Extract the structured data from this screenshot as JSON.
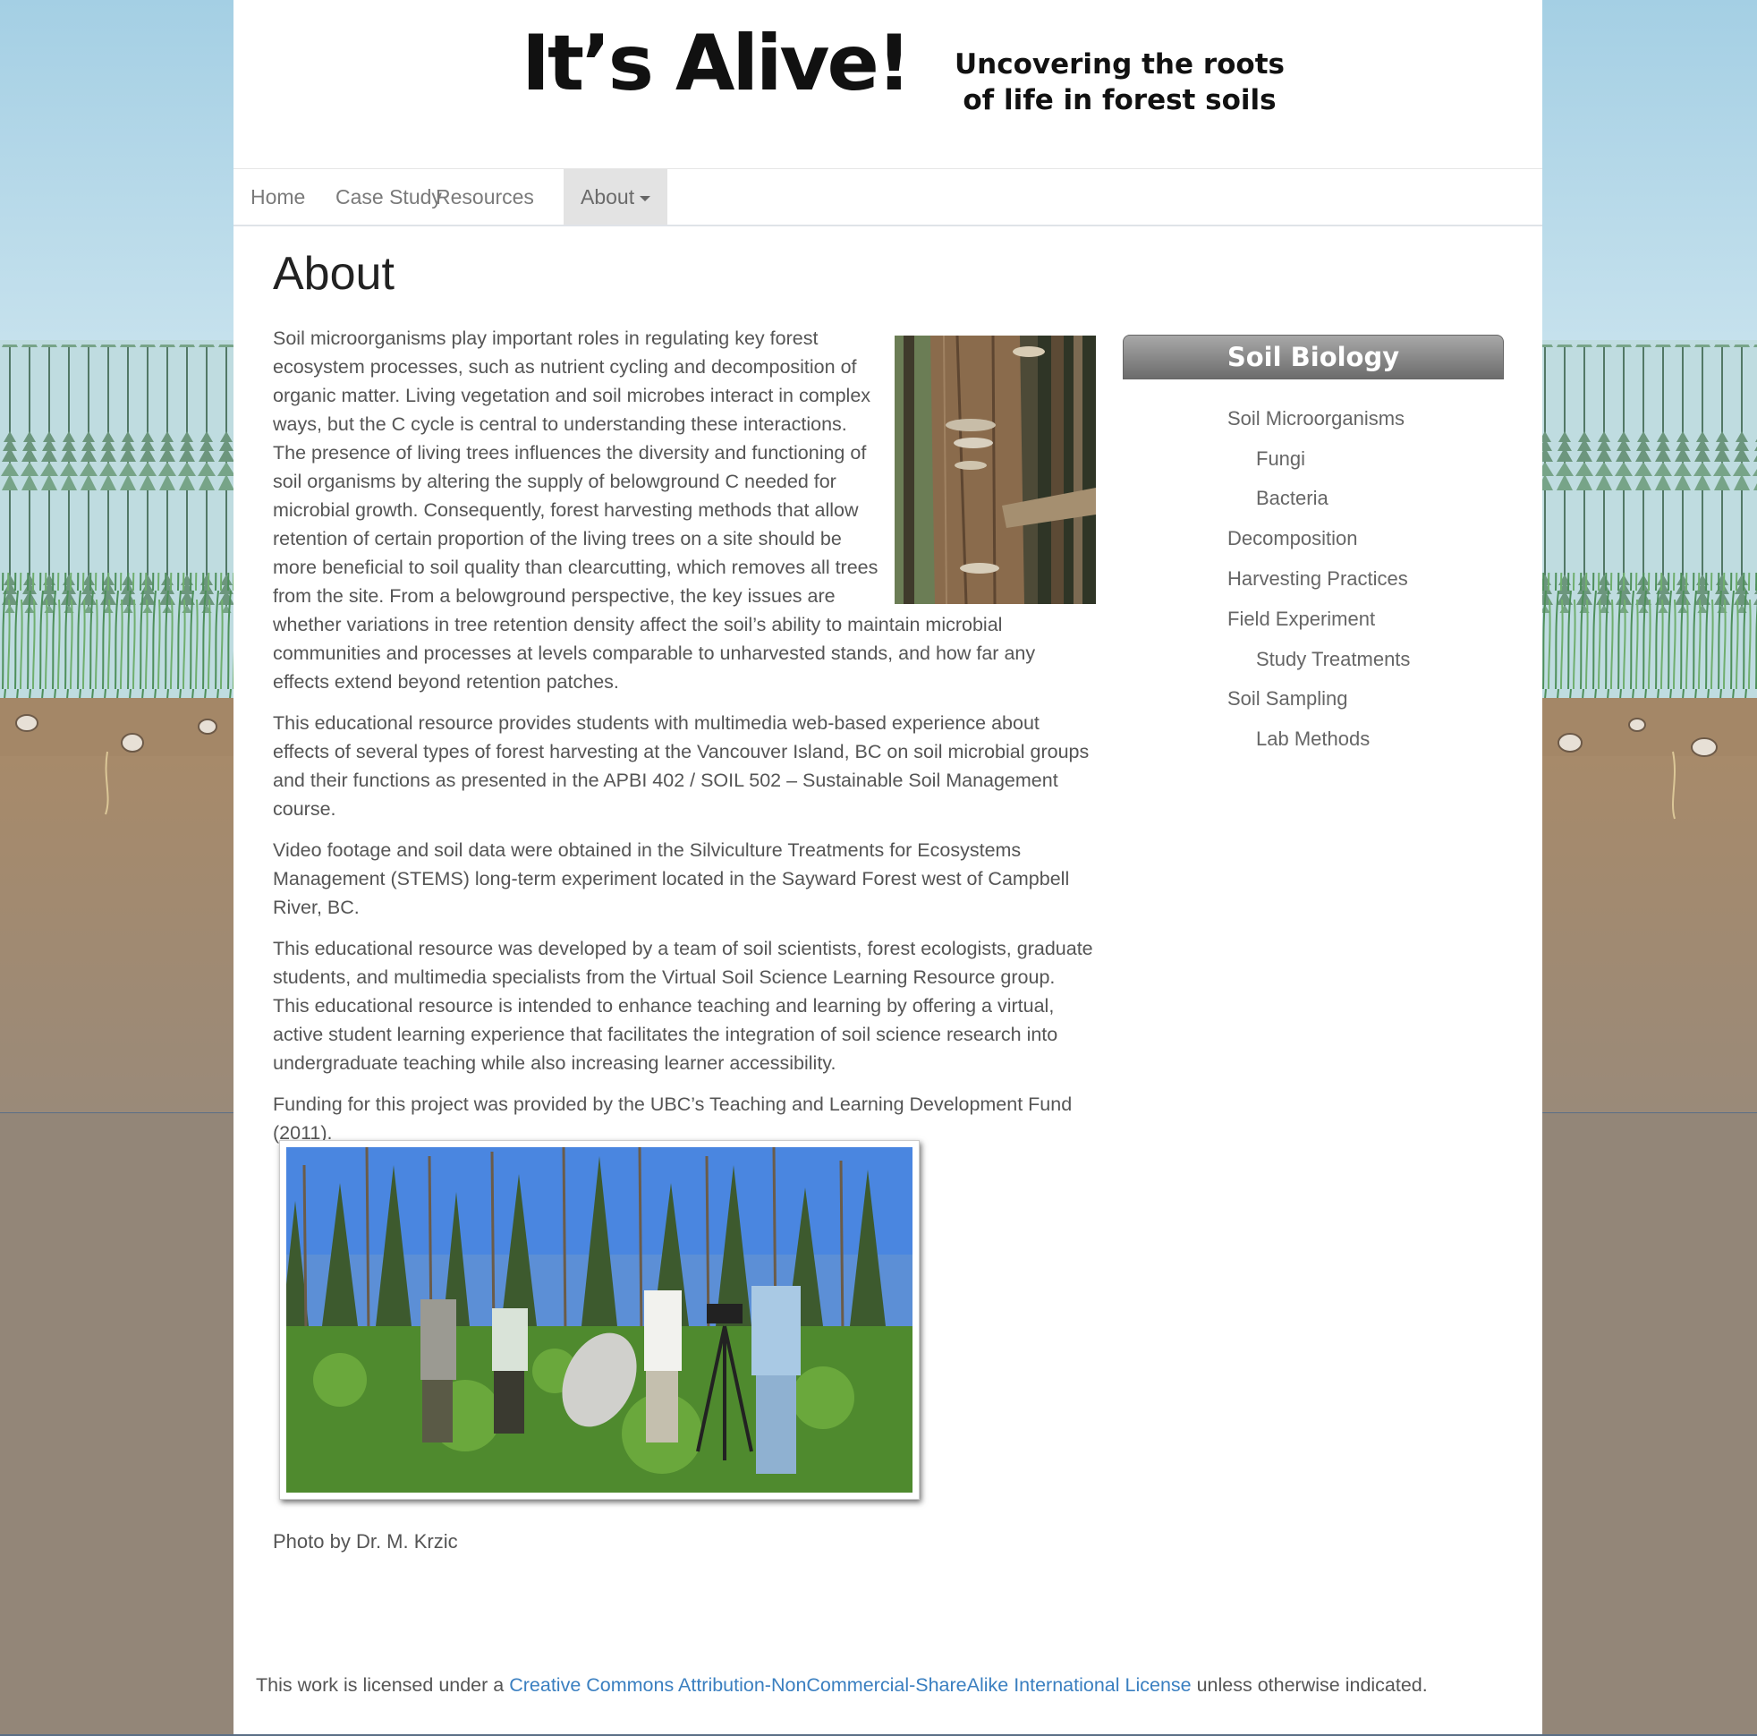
{
  "header": {
    "title": "It’s Alive!",
    "subtitle_line1": "Uncovering the roots",
    "subtitle_line2": "of life in forest soils"
  },
  "nav": {
    "items": [
      {
        "label": "Home"
      },
      {
        "label": "Case Study"
      },
      {
        "label": "Resources"
      },
      {
        "label": "About"
      }
    ]
  },
  "main": {
    "title": "About",
    "paragraphs": [
      "Soil microorganisms play important roles in regulating key forest ecosystem processes, such as nutrient cycling and decomposition of organic matter. Living vegetation and soil microbes interact in complex ways, but the C cycle is central to understanding these interactions.  The presence of living trees influences the diversity and functioning of soil organisms by altering the supply of belowground C needed for microbial growth. Consequently, forest harvesting methods that allow retention of certain proportion of the living trees on a site should be more beneficial to soil quality than clearcutting, which removes all trees from the site. From a belowground perspective, the key issues are whether variations in tree retention density affect the soil’s ability to maintain microbial communities and processes at levels comparable to unharvested stands, and how far any effects extend beyond retention patches.",
      "This educational resource provides students with multimedia web-based experience about effects of several types of forest harvesting at the Vancouver Island, BC on soil microbial groups and their functions as presented in the APBI 402 / SOIL 502 – Sustainable Soil Management course.",
      "Video footage and soil data were obtained in the Silviculture Treatments for Ecosystems Management (STEMS) long-term experiment located in the Sayward Forest west of Campbell River, BC.",
      "This educational resource was developed by a team of soil scientists, forest ecologists, graduate students, and multimedia specialists from the Virtual Soil Science Learning Resource group. This educational resource is intended to enhance teaching and learning by offering a virtual, active student learning experience that facilitates the integration of soil science research into undergraduate teaching while also increasing learner accessibility.",
      "Funding for this project was provided by the UBC’s Teaching and Learning Development Fund (2011)."
    ],
    "photo_caption": "Photo by Dr. M. Krzic"
  },
  "sidebar": {
    "heading": "Soil Biology",
    "links": [
      {
        "label": "Soil Microorganisms"
      },
      {
        "label": "Fungi"
      },
      {
        "label": "Bacteria"
      },
      {
        "label": "Decomposition"
      },
      {
        "label": "Harvesting Practices"
      },
      {
        "label": "Field Experiment"
      },
      {
        "label": "Study Treatments"
      },
      {
        "label": "Soil Sampling"
      },
      {
        "label": "Lab Methods"
      }
    ]
  },
  "footer": {
    "prefix": "This work is licensed under a",
    "license_link": "Creative Commons Attribution-NonCommercial-ShareAlike International License",
    "suffix": "unless otherwise indicated."
  },
  "colors": {
    "sky": "#a9d2e6",
    "soil_brown": "#938678",
    "link_blue": "#3a7fc0",
    "sidebar_gray": "#8a8a8a"
  }
}
